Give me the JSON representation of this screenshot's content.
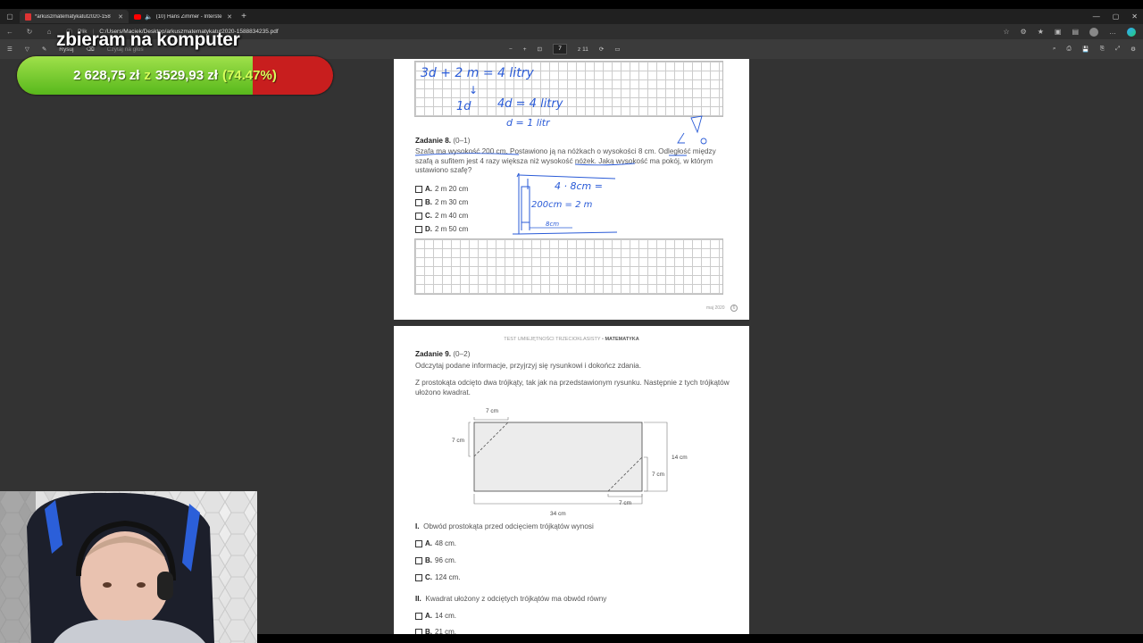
{
  "tabs": [
    {
      "label": "*arkuszmatematykatut2020-158",
      "active": true
    },
    {
      "label": "(10) Hans Zimmer - Interste",
      "active": false
    }
  ],
  "address": {
    "file_label": "Plik",
    "url": "C:/Users/Maciek/Desktop/arkuszmatematykatut2020-1588834235.pdf"
  },
  "pdf_toolbar": {
    "draw_label": "Rysuj",
    "read_aloud_label": "Czytaj na głos",
    "page_current": "7",
    "page_total": "z 11"
  },
  "overlay": {
    "title": "zbieram na komputer",
    "raised": "2 628,75 zł",
    "of": "z",
    "goal": "3529,93 zł",
    "percent_label": "(74.47%)",
    "progress": 0.7447
  },
  "page1": {
    "handwriting": {
      "eq1": "3d + 2 m = 4 litry",
      "eq2": "1d",
      "eq3": "4d = 4 litry",
      "eq4": "d = 1 litr",
      "sketch1": "4 · 8cm =",
      "sketch2": "200cm = 2 m",
      "sketch3": "8cm"
    },
    "task_title": "Zadanie 8.",
    "task_range": "(0–1)",
    "task_text": "Szafa ma wysokość 200 cm. Postawiono ją na nóżkach o wysokości 8 cm. Odległość między szafą a sufitem jest 4 razy większa niż wysokość nóżek. Jaką wysokość ma pokój, w którym ustawiono szafę?",
    "options": [
      {
        "letter": "A.",
        "text": "2 m 20 cm"
      },
      {
        "letter": "B.",
        "text": "2 m 30 cm"
      },
      {
        "letter": "C.",
        "text": "2 m 40 cm"
      },
      {
        "letter": "D.",
        "text": "2 m 50 cm"
      }
    ],
    "footer": "maj 2020",
    "page_number": "6"
  },
  "page2": {
    "header_plain": "TEST UMIEJĘTNOŚCI TRZECIOKLASISTY •",
    "header_bold": "MATEMATYKA",
    "task_title": "Zadanie 9.",
    "task_range": "(0–2)",
    "instruction": "Odczytaj podane informacje, przyjrzyj się rysunkowi i dokończ zdania.",
    "description": "Z prostokąta odcięto dwa trójkąty, tak jak na przedstawionym rysunku. Następnie z tych trójkątów ułożono kwadrat.",
    "figure_labels": {
      "top": "7 cm",
      "left": "7 cm",
      "right_big": "14 cm",
      "right_small": "7 cm",
      "bottom_small": "7 cm",
      "bottom": "34 cm"
    },
    "q1_num": "I.",
    "q1_text": "Obwód prostokąta przed odcięciem trójkątów wynosi",
    "q1_options": [
      {
        "letter": "A.",
        "text": "48 cm."
      },
      {
        "letter": "B.",
        "text": "96 cm."
      },
      {
        "letter": "C.",
        "text": "124 cm."
      }
    ],
    "q2_num": "II.",
    "q2_text": "Kwadrat ułożony z odciętych trójkątów ma obwód równy",
    "q2_options": [
      {
        "letter": "A.",
        "text": "14 cm."
      },
      {
        "letter": "B.",
        "text": "21 cm."
      }
    ]
  },
  "colors": {
    "progress_green": "#7ccf32",
    "progress_red": "#c81e1e",
    "ink_blue": "#2a5bd7"
  }
}
